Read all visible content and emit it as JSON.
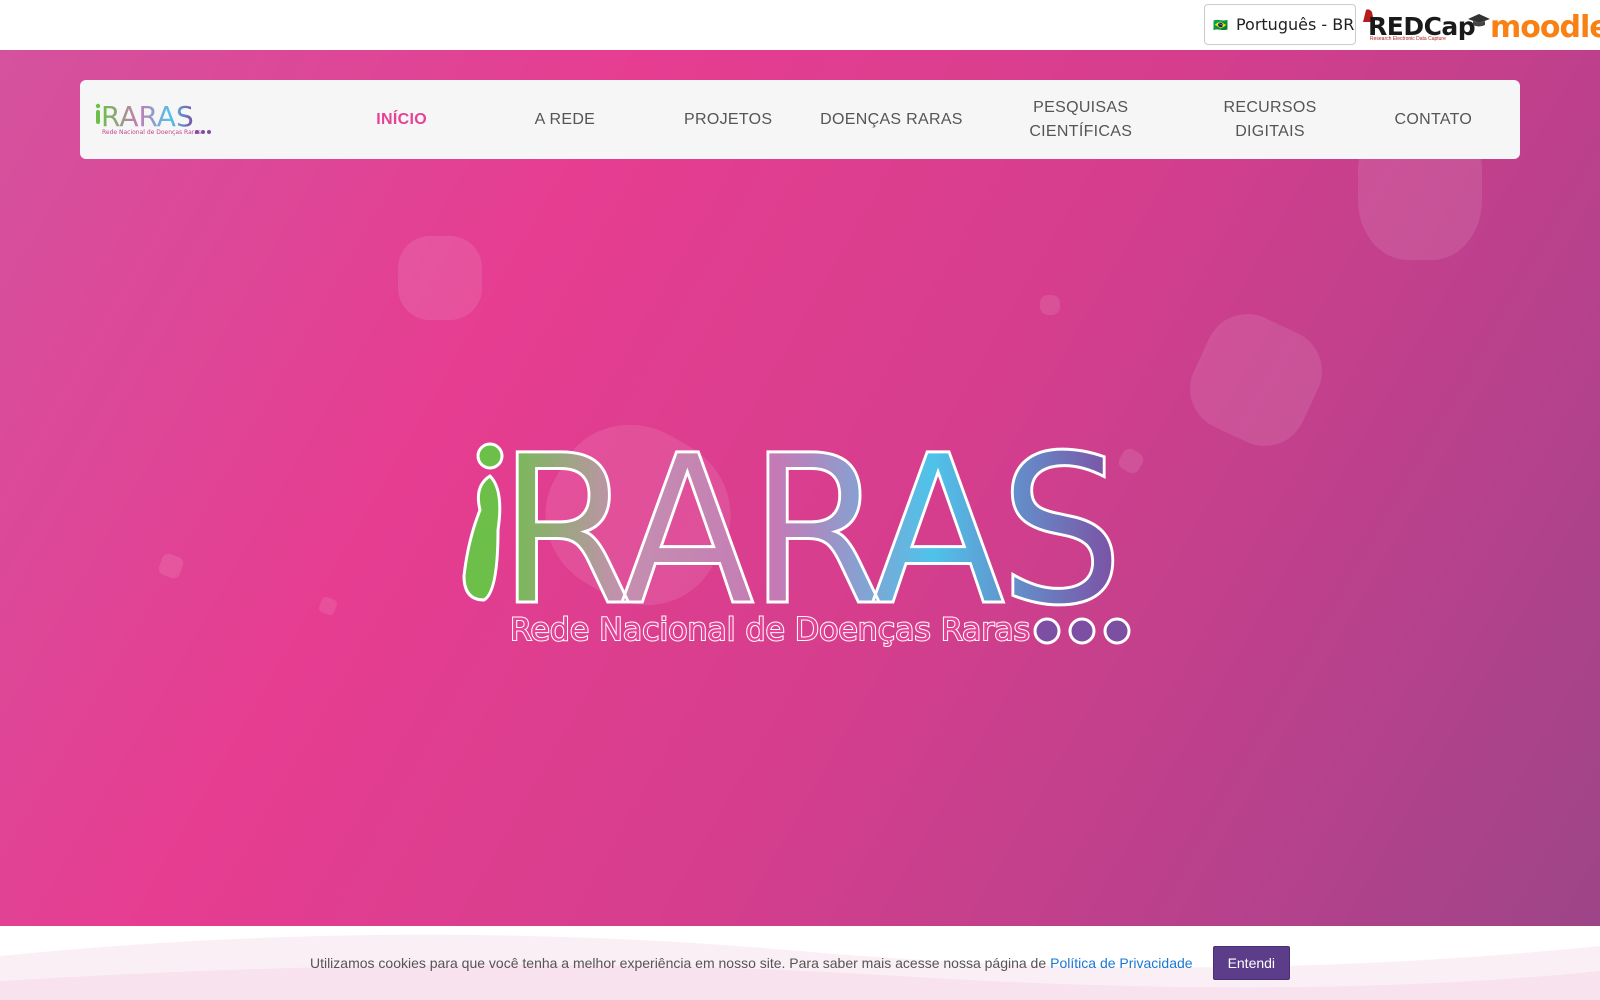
{
  "topbar": {
    "language": "Português - BR",
    "language_flag_icon": "brazil-flag-icon",
    "redcap_logo": "REDCap",
    "redcap_tagline": "Research Electronic Data Capture",
    "moodle_logo": "moodle"
  },
  "nav": {
    "brand": "RARAS",
    "brand_subtitle": "Rede Nacional de Doenças Raras",
    "items": [
      {
        "label": "INÍCIO",
        "active": true
      },
      {
        "label": "A REDE",
        "active": false
      },
      {
        "label": "PROJETOS",
        "active": false
      },
      {
        "label": "DOENÇAS RARAS",
        "active": false
      },
      {
        "label": "PESQUISAS CIENTÍFICAS",
        "active": false
      },
      {
        "label": "RECURSOS DIGITAIS",
        "active": false
      },
      {
        "label": "CONTATO",
        "active": false
      }
    ]
  },
  "hero": {
    "logo_text": "RARAS",
    "logo_subtitle": "Rede Nacional de Doenças Raras"
  },
  "cookie": {
    "message": "Utilizamos cookies para que você tenha a melhor experiência em nosso site. Para saber mais acesse nossa página de",
    "link": "Política de Privacidade",
    "button": "Entendi"
  },
  "colors": {
    "accent_pink": "#e64296",
    "button_purple": "#5b3d8a",
    "link_blue": "#1a78d4",
    "logo_green": "#6cc04a",
    "logo_blue": "#4fc3ea",
    "logo_purple": "#7d4fa3"
  }
}
